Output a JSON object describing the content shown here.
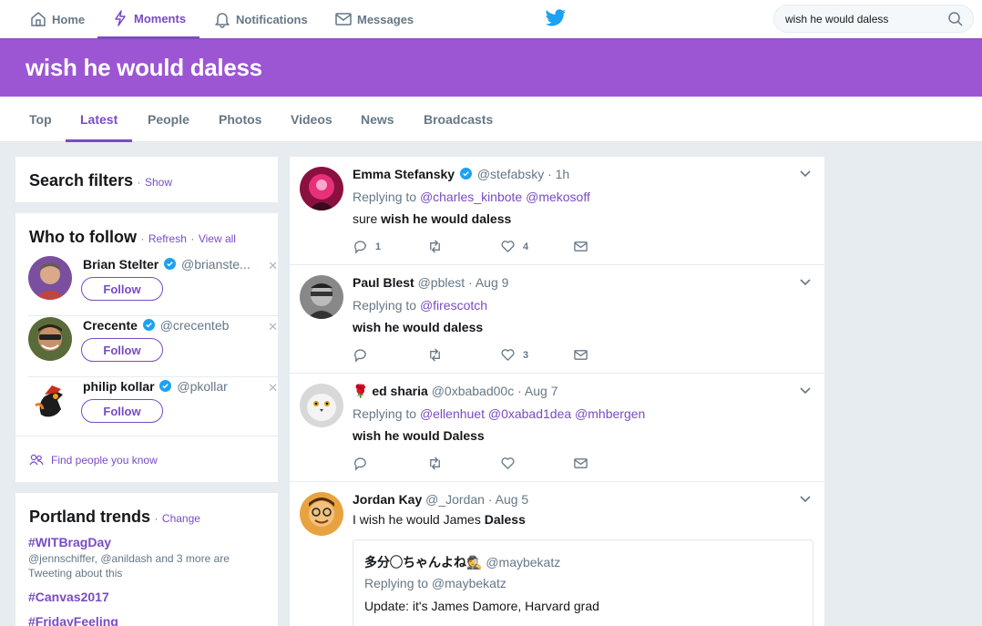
{
  "nav": {
    "home": "Home",
    "moments": "Moments",
    "notifications": "Notifications",
    "messages": "Messages"
  },
  "search": {
    "value": "wish he would daless"
  },
  "banner": {
    "title": "wish he would daless"
  },
  "tabs": [
    "Top",
    "Latest",
    "People",
    "Photos",
    "Videos",
    "News",
    "Broadcasts"
  ],
  "filters": {
    "title": "Search filters",
    "sep": "·",
    "show": "Show"
  },
  "who_to_follow": {
    "title": "Who to follow",
    "sep": "·",
    "refresh": "Refresh",
    "view_all": "View all",
    "follow_label": "Follow",
    "users": [
      {
        "name": "Brian Stelter",
        "handle": "@brianste..."
      },
      {
        "name": "Crecente",
        "handle": "@crecenteb"
      },
      {
        "name": "philip kollar",
        "handle": "@pkollar"
      }
    ],
    "find_people": "Find people you know"
  },
  "trends": {
    "title": "Portland trends",
    "sep": "·",
    "change": "Change",
    "items": [
      {
        "name": "#WITBragDay",
        "meta": "@jennschiffer, @anildash and 3 more are Tweeting about this"
      },
      {
        "name": "#Canvas2017"
      },
      {
        "name": "#FridayFeeling"
      }
    ]
  },
  "tweets": [
    {
      "name": "Emma Stefansky",
      "handle": "@stefabsky",
      "time": "· 1h",
      "replying_prefix": "Replying to",
      "replying_to": "@charles_kinbote @mekosoff",
      "text_plain": "sure",
      "text_bold": "wish he would daless",
      "replies": "1",
      "likes": "4"
    },
    {
      "name": "Paul Blest",
      "handle": "@pblest",
      "time": "· Aug 9",
      "replying_prefix": "Replying to",
      "replying_to": "@firescotch",
      "text_bold": "wish he would daless",
      "likes": "3"
    },
    {
      "name_prefix": "🌹",
      "name": "ed sharia",
      "handle": "@0xbabad00c",
      "time": "· Aug 7",
      "replying_prefix": "Replying to",
      "replying_to": "@ellenhuet @0xabad1dea @mhbergen",
      "text_bold": "wish he would Daless"
    },
    {
      "name": "Jordan Kay",
      "handle": "@_Jordan",
      "time": "· Aug 5",
      "text_plain": "I wish he would James",
      "text_bold": "Daless",
      "quote": {
        "name": "多分◯ちゃんよね🕵",
        "handle": "@maybekatz",
        "replying": "Replying to @maybekatz",
        "text": "Update: it's James Damore, Harvard grad"
      }
    }
  ],
  "colors": {
    "accent": "#794bc4",
    "banner": "#9c55d3",
    "twitter_blue": "#1da1f2"
  }
}
